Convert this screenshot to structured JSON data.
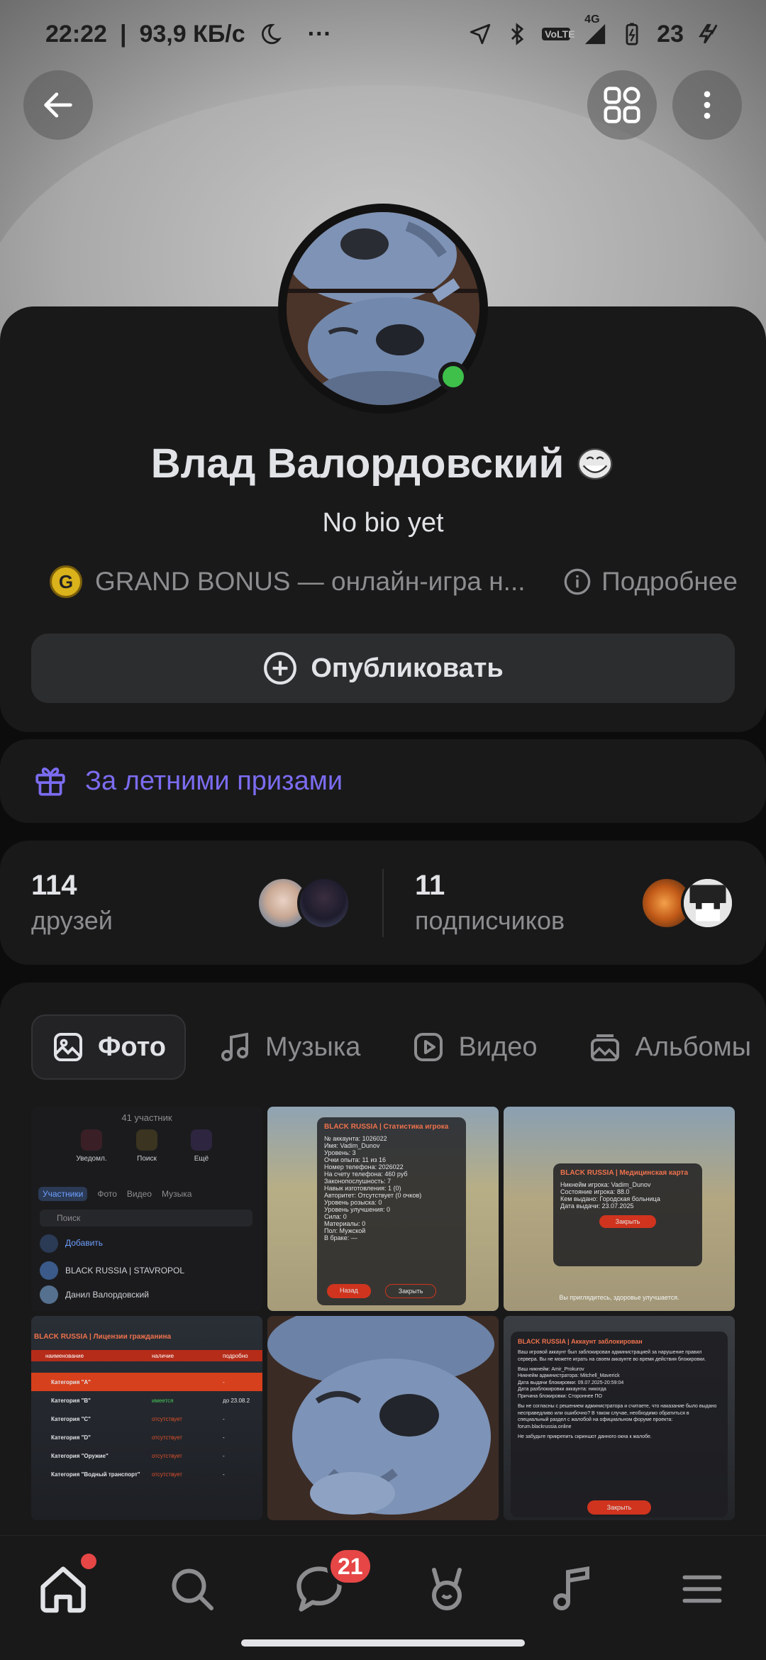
{
  "status_bar": {
    "time": "22:22",
    "speed": "93,9 КБ/с",
    "more": "···",
    "network": "4G",
    "volte": "VoLTE",
    "battery": "23"
  },
  "profile": {
    "name": "Влад Валордовский",
    "bio": "No bio yet",
    "game_name": "GRAND BONUS — онлайн-игра н...",
    "game_logo_letter": "G",
    "more_label": "Подробнее",
    "online": true
  },
  "actions": {
    "publish_label": "Опубликовать"
  },
  "promo": {
    "label": "За летними призами"
  },
  "stats": {
    "friends": {
      "count": "114",
      "label": "друзей"
    },
    "followers": {
      "count": "11",
      "label": "подписчиков"
    }
  },
  "tabs": [
    {
      "label": "Фото",
      "icon": "photo-icon",
      "active": true
    },
    {
      "label": "Музыка",
      "icon": "music-note-icon",
      "active": false
    },
    {
      "label": "Видео",
      "icon": "video-play-icon",
      "active": false
    },
    {
      "label": "Альбомы",
      "icon": "albums-icon",
      "active": false
    }
  ],
  "photos": {
    "p1": {
      "members": "41 участник",
      "btn_notify": "Уведомл.",
      "btn_search": "Поиск",
      "btn_more": "Ещё",
      "tab_members": "Участники",
      "tab_photo": "Фото",
      "tab_video": "Видео",
      "tab_music": "Музыка",
      "search_placeholder": "Поиск",
      "add_label": "Добавить",
      "member1": "BLACK RUSSIA | STAVROPOL",
      "member2": "Данил Валордовский"
    },
    "p2": {
      "title": "BLACK RUSSIA | Статистика игрока",
      "rows": [
        "№ аккаунта: 1026022",
        "Имя: Vadim_Dunov",
        "Уровень: 3",
        "Очки опыта: 11 из 16",
        "Номер телефона: 2026022",
        "На счету телефона: 460 руб",
        "Законопослушность: 7",
        "Навык изготовления: 1 (0)",
        "Авторитет: Отсутствует (0 очков)",
        "Уровень розыска: 0",
        "Уровень улучшения: 0",
        "Сила: 0",
        "Материалы: 0",
        "Пол: Мужской",
        "В браке: —"
      ],
      "btn_back": "Назад",
      "btn_close": "Закрыть"
    },
    "p3": {
      "title": "BLACK RUSSIA | Медицинская карта",
      "rows": [
        "Никнейм игрока: Vadim_Dunov",
        "Состояние игрока: 88.0",
        "Кем выдано: Городская больница",
        "Дата выдачи: 23.07.2025"
      ],
      "btn_close": "Закрыть",
      "footer": "Вы приглядитесь, здоровье улучшается."
    },
    "p4": {
      "title": "BLACK RUSSIA | Лицензии гражданина",
      "col_name": "наименование",
      "col_status": "наличие",
      "col_valid": "подробно",
      "rows": [
        {
          "name": "Категория \"А\"",
          "status": "",
          "valid": "-"
        },
        {
          "name": "Категория \"B\"",
          "status": "имеется",
          "valid": "до 23.08.2"
        },
        {
          "name": "Категория \"C\"",
          "status": "отсутствует",
          "valid": "-"
        },
        {
          "name": "Категория \"D\"",
          "status": "отсутствует",
          "valid": "-"
        },
        {
          "name": "Категория \"Оружие\"",
          "status": "отсутствует",
          "valid": "-"
        },
        {
          "name": "Категория \"Водный транспорт\"",
          "status": "отсутствует",
          "valid": "-"
        }
      ]
    },
    "p6": {
      "title": "BLACK RUSSIA | Аккаунт заблокирован",
      "text1": "Ваш игровой аккаунт был заблокирован администрацией за нарушение правил сервера. Вы не можете играть на своем аккаунте во время действия блокировки.",
      "rows": [
        "Ваш никнейм: Amir_Prokurov",
        "Никнейм администратора: Mitchell_Maverick",
        "Дата выдачи блокировки: 09.07.2025-20:59:04",
        "Дата разблокировки аккаунта: никогда",
        "Причина блокировки: Стороннее ПО"
      ],
      "text2": "Вы не согласны с решением администратора и считаете, что наказание было выдано несправедливо или ошибочно? В таком случае, необходимо обратиться в специальный раздел с жалобой на официальном форуме проекта: forum.blackrussia.online",
      "text3": "Не забудьте прикрепить скриншот данного окна к жалобе.",
      "btn_close": "Закрыть"
    }
  },
  "bottom_nav": {
    "messages_badge": "21"
  },
  "colors": {
    "accent": "#7b6cf0",
    "online": "#3ec04a",
    "badge": "#e64646",
    "surface": "#19191a"
  }
}
